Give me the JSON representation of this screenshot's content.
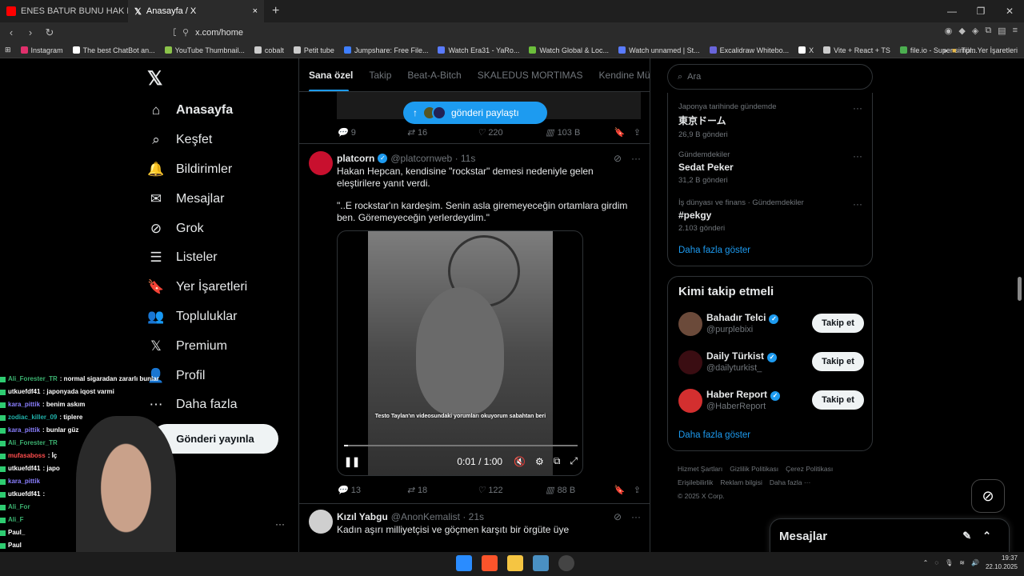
{
  "browser": {
    "tabs": [
      {
        "title": "ENES BATUR BUNU HAK ETMEDİ - Yo"
      },
      {
        "title": "Anasayfa / X",
        "close": "×"
      }
    ],
    "new_tab": "+",
    "url": "x.com/home",
    "window_controls": [
      "—",
      "❐",
      "✕"
    ],
    "bookmarks": [
      {
        "label": "Instagram",
        "color": "#e1306c"
      },
      {
        "label": "The best ChatBot an...",
        "color": "#ffffff"
      },
      {
        "label": "YouTube Thumbnail...",
        "color": "#8bc34a"
      },
      {
        "label": "cobalt",
        "color": "#cccccc"
      },
      {
        "label": "Petit tube",
        "color": "#cccccc"
      },
      {
        "label": "Jumpshare: Free File...",
        "color": "#3f7fff"
      },
      {
        "label": "Watch Era31 - YaRo...",
        "color": "#5a7bff"
      },
      {
        "label": "Watch Global & Loc...",
        "color": "#6cbf3b"
      },
      {
        "label": "Watch unnamed | St...",
        "color": "#5a7bff"
      },
      {
        "label": "Excalidraw Whitebo...",
        "color": "#6965db"
      },
      {
        "label": "X",
        "color": "#ffffff"
      },
      {
        "label": "Vite + React + TS",
        "color": "#cccccc"
      },
      {
        "label": "file.io - Super simpl...",
        "color": "#4caf50"
      }
    ],
    "bookmarks_more": "»",
    "all_bookmarks": "Tüm Yer İşaretleri"
  },
  "x_sidebar": {
    "logo": "𝕏",
    "items": [
      {
        "label": "Anasayfa",
        "icon": "⌂"
      },
      {
        "label": "Keşfet",
        "icon": "⌕"
      },
      {
        "label": "Bildirimler",
        "icon": "🔔"
      },
      {
        "label": "Mesajlar",
        "icon": "✉"
      },
      {
        "label": "Grok",
        "icon": "⊘"
      },
      {
        "label": "Listeler",
        "icon": "☰"
      },
      {
        "label": "Yer İşaretleri",
        "icon": "🔖"
      },
      {
        "label": "Topluluklar",
        "icon": "👥"
      },
      {
        "label": "Premium",
        "icon": "𝕏"
      },
      {
        "label": "Profil",
        "icon": "👤"
      },
      {
        "label": "Daha fazla",
        "icon": "⋯"
      }
    ],
    "post_button": "Gönderi yayınla",
    "more": "···"
  },
  "chat": [
    {
      "user": "Ali_Forester_TR",
      "msg": ": normal sigaradan zararlı bunlar",
      "color": "#3cb371"
    },
    {
      "user": "utkuefdf41",
      "msg": ": japonyada iqost varmi",
      "color": "#ffffff"
    },
    {
      "user": "kara_pittik",
      "msg": ": benim askım",
      "color": "#8a7fff"
    },
    {
      "user": "zodiac_killer_09",
      "msg": ": tiplere",
      "color": "#20b2aa"
    },
    {
      "user": "kara_pittik",
      "msg": ": bunlar güz",
      "color": "#8a7fff"
    },
    {
      "user": "Ali_Forester_TR",
      "msg": "",
      "color": "#3cb371"
    },
    {
      "user": "mufasaboss",
      "msg": ": İç",
      "color": "#ff4d4d"
    },
    {
      "user": "utkuefdf41",
      "msg": ": japo",
      "color": "#ffffff"
    },
    {
      "user": "kara_pittik",
      "msg": "",
      "color": "#8a7fff"
    },
    {
      "user": "utkuefdf41",
      "msg": ":",
      "color": "#ffffff"
    },
    {
      "user": "Ali_For",
      "msg": "",
      "color": "#3cb371"
    },
    {
      "user": "Ali_F",
      "msg": "",
      "color": "#3cb371"
    },
    {
      "user": "Paul_",
      "msg": "",
      "color": "#ffffff"
    },
    {
      "user": "Paul",
      "msg": "",
      "color": "#ffffff"
    },
    {
      "user": "Pa",
      "msg": "",
      "color": "#ffffff"
    }
  ],
  "timeline": {
    "tabs": [
      "Sana özel",
      "Takip",
      "Beat-A-Bitch",
      "SKALEDUS MORTIMAS",
      "Kendine Müz"
    ],
    "share_pill": "gönderi paylaştı",
    "share_arrow": "↑",
    "prev_actions": {
      "replies": "9",
      "reposts": "16",
      "likes": "220",
      "views": "103 B"
    },
    "post1": {
      "name": "platcorn",
      "handle": "@platcornweb · 11s",
      "text1": "Hakan Hepcan, kendisine \"rockstar\" demesi nedeniyle gelen eleştirilere yanıt verdi.",
      "text2": "\"..E rockstar'ın kardeşim. Senin asla giremeyeceğin ortamlara girdim ben. Göremeyeceğin yerlerdeydim.\"",
      "video_caption": "Testo Taylan'ın videosundaki yorumları okuyorum sabahtan beri",
      "video_time": "0:01 / 1:00",
      "video_progress": 0.017,
      "actions": {
        "replies": "13",
        "reposts": "18",
        "likes": "122",
        "views": "88 B"
      }
    },
    "post2": {
      "name": "Kızıl Yabgu",
      "handle": "@AnonKemalist · 21s",
      "text": "Kadın aşırı milliyetçisi ve göçmen karşıtı bir örgüte üye"
    }
  },
  "right": {
    "search_placeholder": "Ara",
    "trends": [
      {
        "meta": "Japonya tarihinde gündemde",
        "name": "東京ドーム",
        "count": "26,9 B gönderi"
      },
      {
        "meta": "Gündemdekiler",
        "name": "Sedat Peker",
        "count": "31,2 B gönderi"
      },
      {
        "meta": "İş dünyası ve finans · Gündemdekiler",
        "name": "#pekgy",
        "count": "2.103 gönderi"
      }
    ],
    "trends_more": "Daha fazla göster",
    "who_title": "Kimi takip etmeli",
    "who": [
      {
        "name": "Bahadır Telci",
        "handle": "@purplebixi",
        "color": "#6b4a3a"
      },
      {
        "name": "Daily Türkist",
        "handle": "@dailyturkist_",
        "color": "#3a0d12"
      },
      {
        "name": "Haber Report",
        "handle": "@HaberReport",
        "color": "#d32f2f"
      }
    ],
    "follow_label": "Takip et",
    "who_more": "Daha fazla göster",
    "footer": [
      "Hizmet Şartları",
      "Gizlilik Politikası",
      "Çerez Politikası",
      "Erişilebilirlik",
      "Reklam bilgisi",
      "Daha fazla ···",
      "© 2025 X Corp."
    ]
  },
  "messages_dock": {
    "title": "Mesajlar"
  },
  "taskbar": {
    "time": "19:37",
    "date": "22.10.2025"
  },
  "colors": {
    "accent": "#1d9bf0",
    "background": "#000000",
    "border": "#2f3336"
  }
}
